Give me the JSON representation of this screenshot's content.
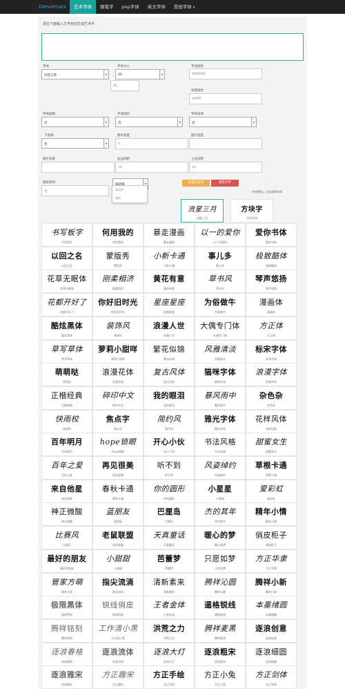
{
  "navbar": {
    "brand": "DimoleSars",
    "items": [
      {
        "label": "艺术字体",
        "active": true
      },
      {
        "label": "钢笔字",
        "active": false
      },
      {
        "label": "pop字体",
        "active": false
      },
      {
        "label": "英文字体",
        "active": false
      },
      {
        "label": "其他字体",
        "active": false,
        "dropdown": true
      }
    ]
  },
  "form": {
    "hint": "请在下面输入文字自动生成艺术字",
    "text_value": "",
    "font_label": "字体",
    "font_value": "刘佳三月",
    "size_label": "字体大小",
    "size_value": "40",
    "size_extra": "40",
    "text_color_label": "字体颜色",
    "text_color_value": "#f00000",
    "bg_color_label": "背景颜色",
    "bg_color_value": "#ffffff",
    "bold_label": "字体加粗",
    "bold_value": "否",
    "italic_label": "字体倾斜",
    "italic_value": "否",
    "underline_label": "字体斜体",
    "underline_value": "否",
    "shadow_label": "下划线",
    "shadow_value": "否",
    "image_height_label": "图片高度",
    "image_height_value": "0",
    "image_width_label": "图片宽度",
    "image_width_value": "",
    "bg_image_label": "图片背景",
    "bg_image_value": "",
    "left_margin_label": "左边间距",
    "left_margin_value": "10",
    "top_margin_label": "上边间距",
    "top_margin_value": "10",
    "layout_label": "图形排列",
    "layout_value": "否",
    "select_placeholder": "请选择",
    "dropdown_options": [
      "请选择",
      "横排"
    ],
    "generate_button": "生成艺术字",
    "reset_button": "清空文字",
    "note": "字体预览，点击选择字体"
  },
  "featured": [
    {
      "sample": "流星三月",
      "caption": "流星三月"
    },
    {
      "sample": "方块字",
      "caption": "方块字体"
    }
  ],
  "fonts": [
    [
      "书写板字",
      "何用我的",
      "暴走漫画",
      "以一的爱你",
      "爱你书体"
    ],
    [
      "以回之名",
      "蒙版秀",
      "小新卡通",
      "事儿多",
      "极致酷体"
    ],
    [
      "花草无眠体",
      "刚柔相济",
      "黄花有意",
      "草书风",
      "琴声悠扬"
    ],
    [
      "花都开好了",
      "你好旧时光",
      "星座星座",
      "为俗做牛",
      "漫画体"
    ],
    [
      "酷炫黑体",
      "装饰风",
      "浪漫人世",
      "大偶专门体",
      "方正体"
    ],
    [
      "草写草体",
      "萝莉小甜咩",
      "繁花似锦",
      "风雅清淡",
      "标宋字体"
    ],
    [
      "萌萌哒",
      "浪漫花体",
      "复古风体",
      "猫咪字体",
      "浪漫字体"
    ],
    [
      "正楷经典",
      "碎印中文",
      "我的眼泪",
      "暴风雨中",
      "杂色杂"
    ],
    [
      "快雨校",
      "焦点字",
      "简约风",
      "雅光字体",
      "花样风体"
    ],
    [
      "百年明月",
      "hope锁眼",
      "开心小伙",
      "书法风格",
      "甜蜜女生"
    ],
    [
      "百年之爱",
      "再见很美",
      "听不到",
      "风姿绰约",
      "草根卡通"
    ],
    [
      "来自他星",
      "春秋卡通",
      "你的圆形",
      "小星星",
      "爱彩虹"
    ],
    [
      "神正微酸",
      "蓝朋友",
      "巴厘岛",
      "杰的其年",
      "精年小情"
    ],
    [
      "比赛风",
      "老鼠联盟",
      "天真童话",
      "暖心的梦",
      "俏皮柜子"
    ],
    [
      "最好的朋友",
      "小甜甜",
      "芭蕾梦",
      "只愿如梦",
      "方正华隶"
    ],
    [
      "管家方萌",
      "指尖流淌",
      "清新素来",
      "腾祥沁圆",
      "腾祥小新"
    ],
    [
      "极限黑体",
      "锐线俏皮",
      "王者金体",
      "逼格锐线",
      "本墨绪圆"
    ],
    [
      "腾祥铭刻",
      "工作清小黑",
      "洪荒之力",
      "腾祥麦黑",
      "逐浪创意"
    ],
    [
      "逐浪春格",
      "逐浪流体",
      "逐浪大灯",
      "逐浪粗宋",
      "逐浪细圆"
    ],
    [
      "逐浪雅宋",
      "方正趣宋",
      "方正手绘",
      "方正小兔",
      "方正剑体"
    ]
  ]
}
